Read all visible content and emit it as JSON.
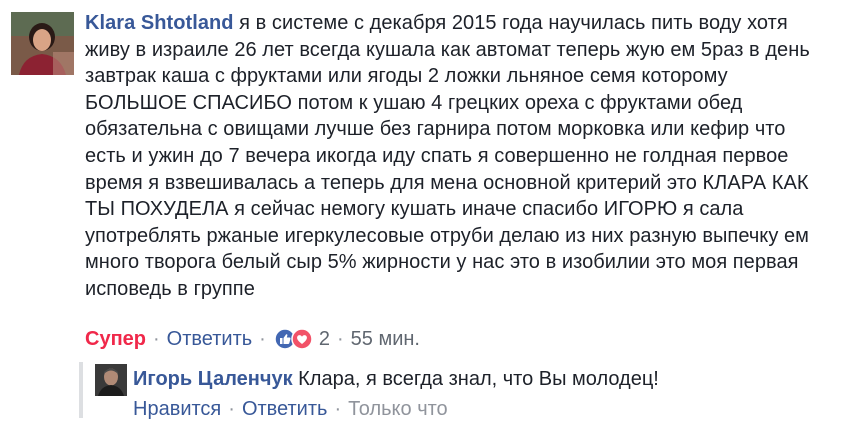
{
  "comment": {
    "author": "Klara Shtotland",
    "text": "я в системе с декабря 2015 года научилась пить воду хотя живу в израиле 26 лет всегда кушала как автомат теперь жую ем 5раз в день завтрак каша с фруктами или ягоды 2 ложки льняное семя которому БОЛЬШОЕ СПАСИБО потом к ушаю 4 грецких ореха с фруктами обед обязательна с овищами лучше без гарнира потом морковка или кефир что есть и ужин до 7 вечера икогда иду спать я совершенно не голдная первое время я взвешивалась а теперь для мена основной критерий это КЛАРА КАК ТЫ ПОХУДЕЛА я сейчас немогу кушать иначе спасибо ИГОРЮ я сала употреблять ржаные игеркулесовые отруби делаю из них разную выпечку ем много творога белый сыр 5% жирности у нас это в изобилии это моя первая исповедь в группе",
    "reaction_label": "Супер",
    "reply_action": "Ответить",
    "reaction_icons": [
      "like-icon",
      "love-icon"
    ],
    "reaction_count": "2",
    "timestamp": "55 мин."
  },
  "reply": {
    "author": "Игорь Цаленчук",
    "text": "Клара, я всегда знал, что Вы молодец!",
    "like_action": "Нравится",
    "reply_action": "Ответить",
    "timestamp": "Только что"
  },
  "colors": {
    "author_link": "#385898",
    "text": "#1d2129",
    "meta": "#606770",
    "super": "#f0284a",
    "like_blue": "#4267b2",
    "love_red": "#f25268"
  }
}
